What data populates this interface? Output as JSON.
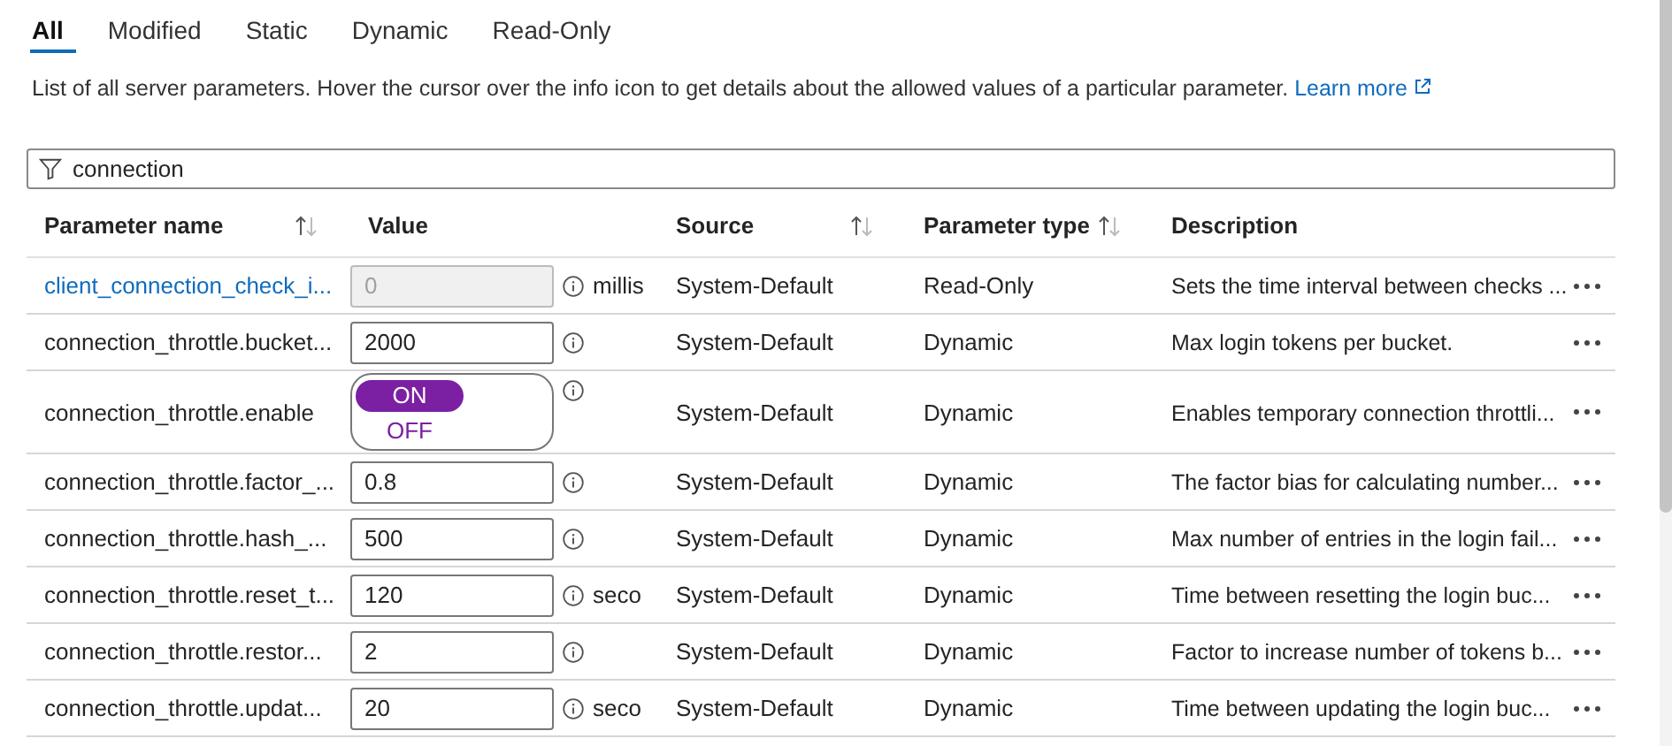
{
  "tabs": [
    {
      "label": "All",
      "selected": true
    },
    {
      "label": "Modified",
      "selected": false
    },
    {
      "label": "Static",
      "selected": false
    },
    {
      "label": "Dynamic",
      "selected": false
    },
    {
      "label": "Read-Only",
      "selected": false
    }
  ],
  "intro": {
    "text": "List of all server parameters. Hover the cursor over the info icon to get details about the allowed values of a particular parameter.",
    "link": "Learn more"
  },
  "filter": {
    "value": "connection"
  },
  "table": {
    "columns": [
      {
        "label": "Parameter name",
        "sortable": true
      },
      {
        "label": "Value",
        "sortable": false
      },
      {
        "label": "Source",
        "sortable": true
      },
      {
        "label": "Parameter type",
        "sortable": true
      },
      {
        "label": "Description",
        "sortable": false
      }
    ],
    "rows": [
      {
        "name": "client_connection_check_i...",
        "link": true,
        "kind": "input",
        "value": "0",
        "disabled": true,
        "unit": "millis",
        "source": "System-Default",
        "type": "Read-Only",
        "description": "Sets the time interval between checks ..."
      },
      {
        "name": "connection_throttle.bucket...",
        "link": false,
        "kind": "input",
        "value": "2000",
        "disabled": false,
        "source": "System-Default",
        "type": "Dynamic",
        "description": "Max login tokens per bucket."
      },
      {
        "name": "connection_throttle.enable",
        "link": false,
        "kind": "toggle",
        "on": true,
        "on_label": "ON",
        "off_label": "OFF",
        "source": "System-Default",
        "type": "Dynamic",
        "description": "Enables temporary connection throttli..."
      },
      {
        "name": "connection_throttle.factor_...",
        "link": false,
        "kind": "input",
        "value": "0.8",
        "disabled": false,
        "source": "System-Default",
        "type": "Dynamic",
        "description": "The factor bias for calculating number..."
      },
      {
        "name": "connection_throttle.hash_...",
        "link": false,
        "kind": "input",
        "value": "500",
        "disabled": false,
        "source": "System-Default",
        "type": "Dynamic",
        "description": "Max number of entries in the login fail..."
      },
      {
        "name": "connection_throttle.reset_t...",
        "link": false,
        "kind": "input",
        "value": "120",
        "disabled": false,
        "unit": "seco",
        "source": "System-Default",
        "type": "Dynamic",
        "description": "Time between resetting the login buc..."
      },
      {
        "name": "connection_throttle.restor...",
        "link": false,
        "kind": "input",
        "value": "2",
        "disabled": false,
        "source": "System-Default",
        "type": "Dynamic",
        "description": "Factor to increase number of tokens b..."
      },
      {
        "name": "connection_throttle.updat...",
        "link": false,
        "kind": "input",
        "value": "20",
        "disabled": false,
        "unit": "seco",
        "source": "System-Default",
        "type": "Dynamic",
        "description": "Time between updating the login buc..."
      }
    ]
  }
}
